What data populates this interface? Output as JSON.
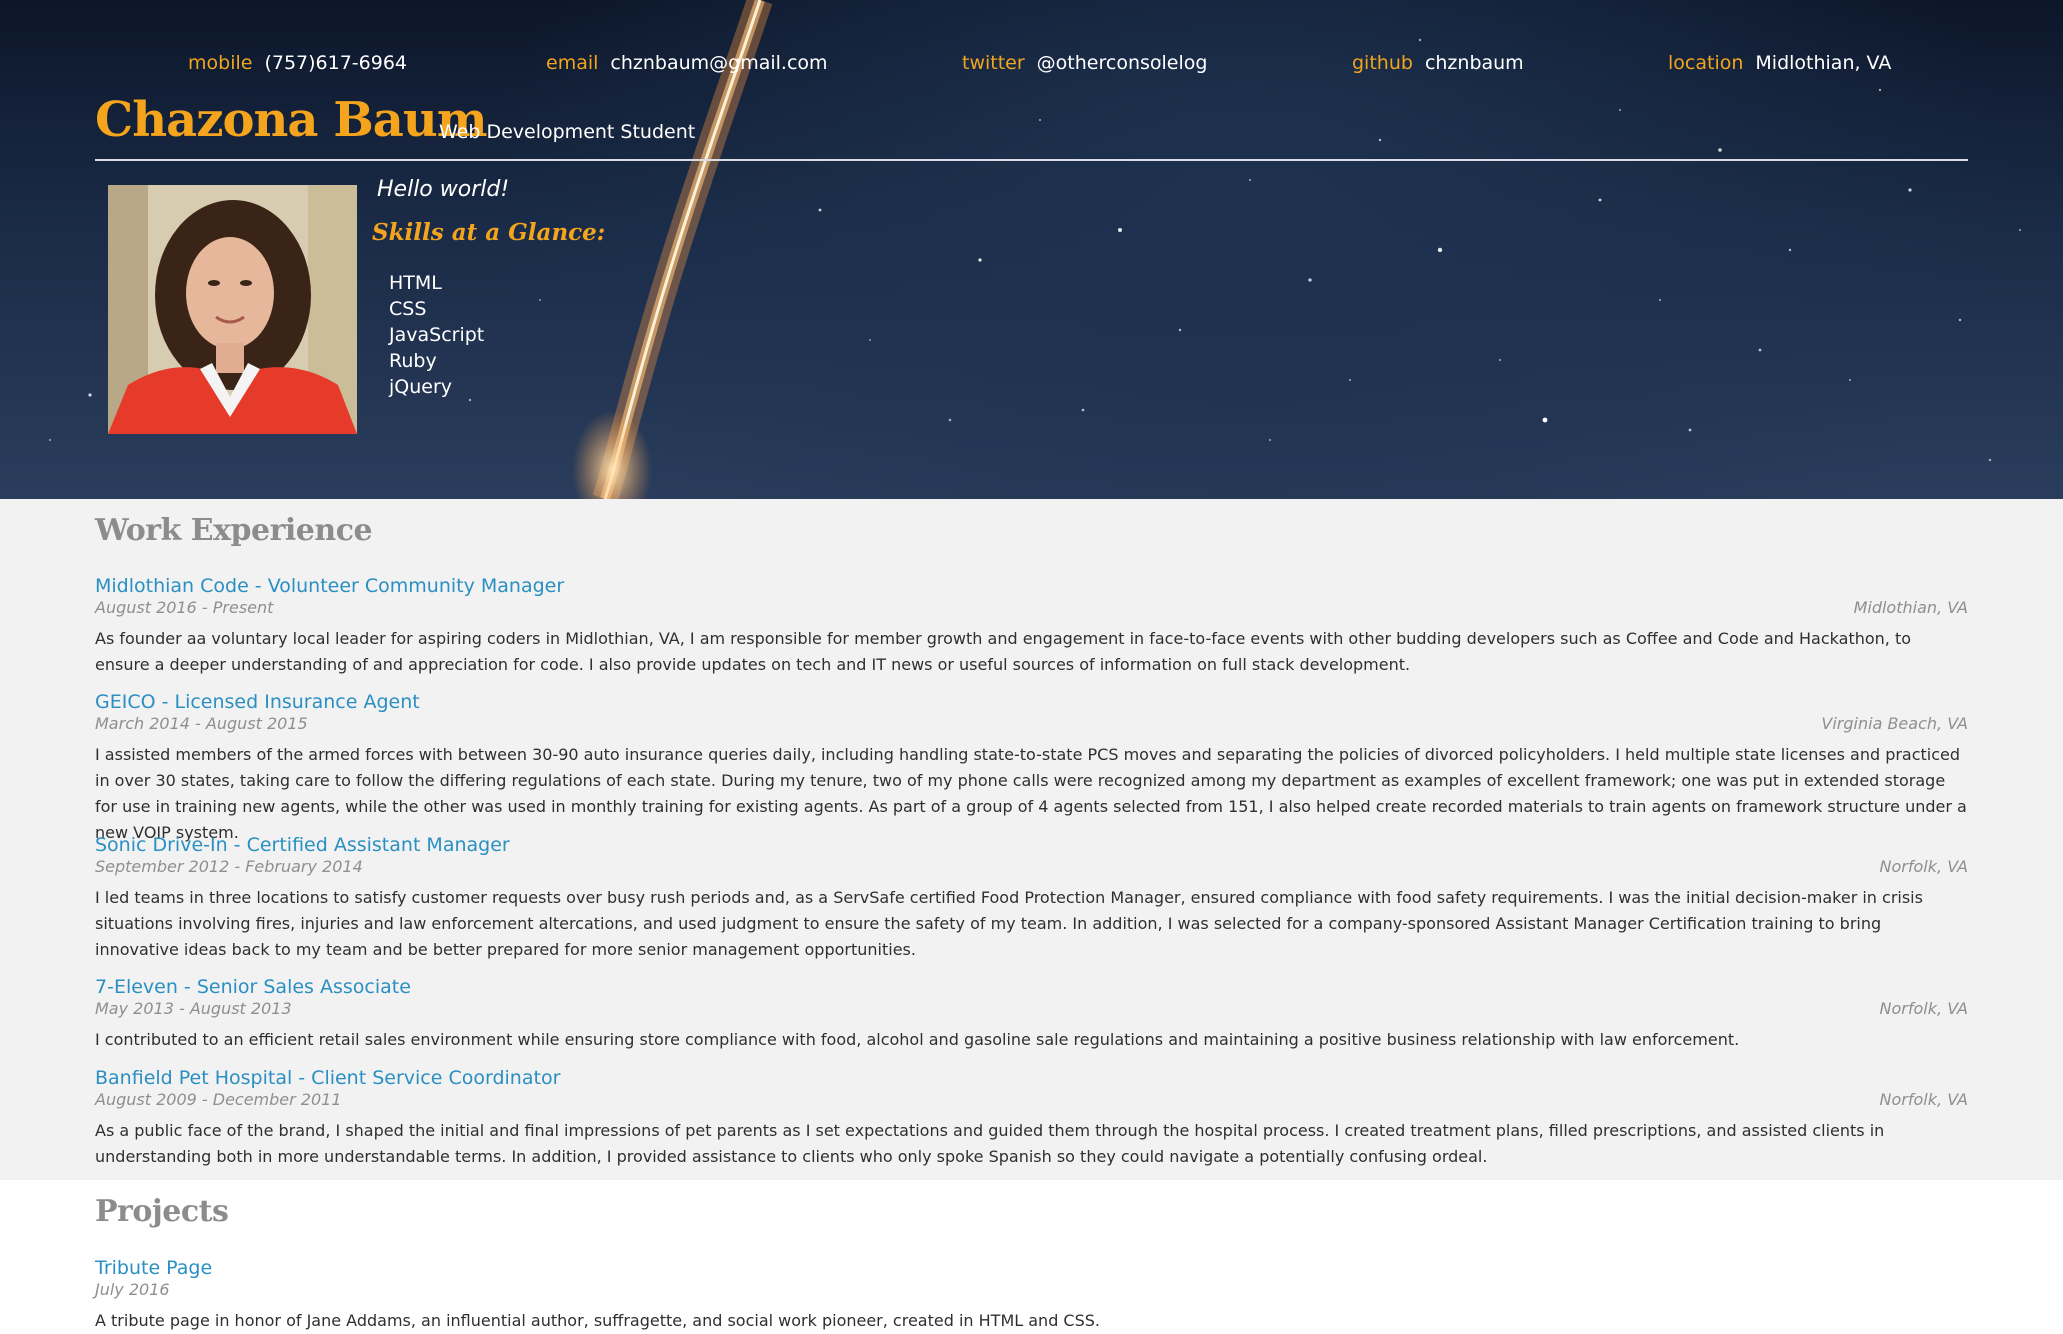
{
  "contact": {
    "mobile": {
      "label": "mobile",
      "value": "(757)617-6964"
    },
    "email": {
      "label": "email",
      "value": "chznbaum@gmail.com"
    },
    "twitter": {
      "label": "twitter",
      "value": "@otherconsolelog"
    },
    "github": {
      "label": "github",
      "value": "chznbaum"
    },
    "location": {
      "label": "location",
      "value": "Midlothian, VA"
    }
  },
  "header": {
    "name": "Chazona Baum",
    "tagline": "Web Development Student",
    "greeting": "Hello world!",
    "skills_title": "Skills at a Glance:",
    "skills": [
      "HTML",
      "CSS",
      "JavaScript",
      "Ruby",
      "jQuery"
    ]
  },
  "work": {
    "title": "Work Experience",
    "jobs": [
      {
        "title": "Midlothian Code - Volunteer Community Manager",
        "dates": "August 2016 - Present",
        "location": "Midlothian, VA",
        "description": "As founder aa voluntary local leader for aspiring coders in Midlothian, VA, I am responsible for member growth and engagement in face-to-face events with other budding developers such as Coffee and Code and Hackathon, to ensure a deeper understanding of and appreciation for code. I also provide updates on tech and IT news or useful sources of information on full stack development."
      },
      {
        "title": "GEICO - Licensed Insurance Agent",
        "dates": "March 2014 - August 2015",
        "location": "Virginia Beach, VA",
        "description": "I assisted members of the armed forces with between 30-90 auto insurance queries daily, including handling state-to-state PCS moves and separating the policies of divorced policyholders. I held multiple state licenses and practiced in over 30 states, taking care to follow the differing regulations of each state. During my tenure, two of my phone calls were recognized among my department as examples of excellent framework; one was put in extended storage for use in training new agents, while the other was used in monthly training for existing agents. As part of a group of 4 agents selected from 151, I also helped create recorded materials to train agents on framework structure under a new VOIP system."
      },
      {
        "title": "Sonic Drive-In - Certified Assistant Manager",
        "dates": "September 2012 - February 2014",
        "location": "Norfolk, VA",
        "description": "I led teams in three locations to satisfy customer requests over busy rush periods and, as a ServSafe certified Food Protection Manager, ensured compliance with food safety requirements. I was the initial decision-maker in crisis situations involving fires, injuries and law enforcement altercations, and used judgment to ensure the safety of my team. In addition, I was selected for a company-sponsored Assistant Manager Certification training to bring innovative ideas back to my team and be better prepared for more senior management opportunities."
      },
      {
        "title": "7-Eleven - Senior Sales Associate",
        "dates": "May 2013 - August 2013",
        "location": "Norfolk, VA",
        "description": "I contributed to an efficient retail sales environment while ensuring store compliance with food, alcohol and gasoline sale regulations and maintaining a positive business relationship with law enforcement."
      },
      {
        "title": "Banfield Pet Hospital - Client Service Coordinator",
        "dates": "August 2009 - December 2011",
        "location": "Norfolk, VA",
        "description": "As a public face of the brand, I shaped the initial and final impressions of pet parents as I set expectations and guided them through the hospital process. I created treatment plans, filled prescriptions, and assisted clients in understanding both in more understandable terms. In addition, I provided assistance to clients who only spoke Spanish so they could navigate a potentially confusing ordeal."
      }
    ]
  },
  "projects": {
    "title": "Projects",
    "items": [
      {
        "title": "Tribute Page",
        "dates": "July 2016",
        "description": "A tribute page in honor of Jane Addams, an influential author, suffragette, and social work pioneer, created in HTML and CSS."
      }
    ]
  },
  "colors": {
    "accent": "#f5a41d",
    "link": "#2a8fc2",
    "muted": "#8f8f8f",
    "hero_bg": "#14223b",
    "section_bg": "#f2f2f2"
  }
}
